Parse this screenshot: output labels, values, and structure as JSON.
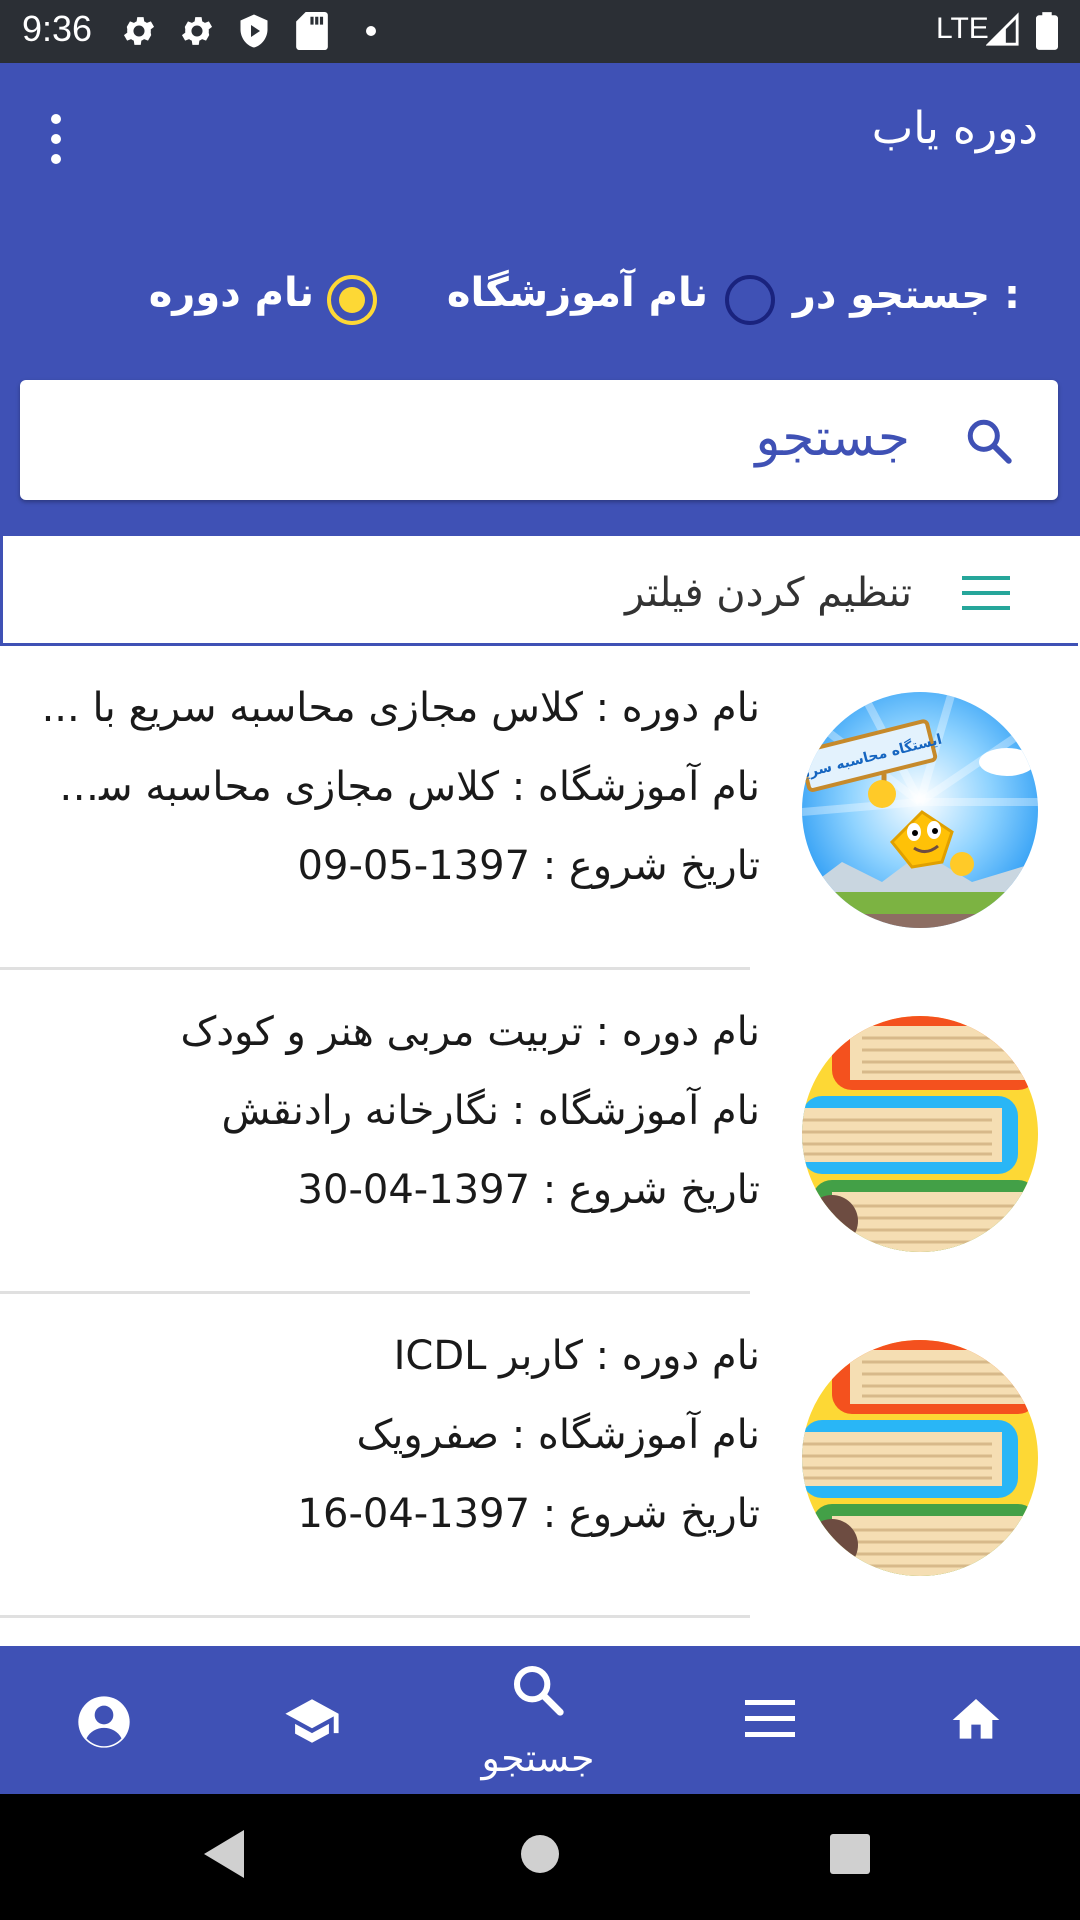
{
  "status_bar": {
    "time": "9:36",
    "network": "LTE"
  },
  "app_bar": {
    "title": "دوره یاب",
    "overflow_icon": "more-vert-icon"
  },
  "search": {
    "search_in_label": "جستجو در :",
    "radio_options": [
      {
        "label": "نام آموزشگاه",
        "selected": false
      },
      {
        "label": "نام دوره",
        "selected": true
      }
    ],
    "placeholder": "جستجو",
    "accent_color": "#3f51b5",
    "radio_selected_color": "#fdd835"
  },
  "filter": {
    "label": "تنظیم کردن فیلتر",
    "icon": "menu-icon",
    "icon_color": "#26a69a"
  },
  "courses": [
    {
      "name_line": "نام دوره : کلاس مجازی محاسبه سریع با ...",
      "institute_line": "نام آموزشگاه : کلاس مجازی محاسبه سری..",
      "date_line": "تاریخ شروع : 1397-05-09",
      "thumb": "mascot-image",
      "thumb_sign_text": "ایستگاه محاسبه سریع"
    },
    {
      "name_line": "نام دوره : تربیت مربی هنر و کودک",
      "institute_line": "نام آموزشگاه : نگارخانه رادنقش",
      "date_line": "تاریخ شروع : 1397-04-30",
      "thumb": "books-image"
    },
    {
      "name_line": "نام دوره : کاربر ICDL",
      "institute_line": "نام آموزشگاه : صفرویک",
      "date_line": "تاریخ شروع : 1397-04-16",
      "thumb": "books-image"
    }
  ],
  "bottom_nav": {
    "items": [
      {
        "icon": "account-icon",
        "label": ""
      },
      {
        "icon": "school-icon",
        "label": ""
      },
      {
        "icon": "search-icon",
        "label": "جستجو",
        "active": true
      },
      {
        "icon": "menu-icon",
        "label": ""
      },
      {
        "icon": "home-icon",
        "label": ""
      }
    ]
  }
}
